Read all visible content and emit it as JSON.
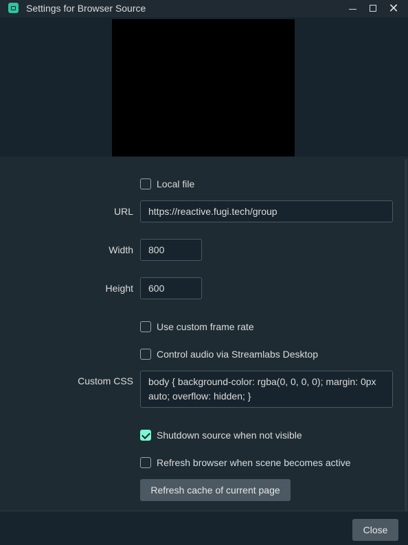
{
  "window": {
    "title": "Settings for Browser Source",
    "icon": "streamlabs-app-icon",
    "controls": [
      "minimize",
      "maximize",
      "close"
    ],
    "close_glyph": "✕"
  },
  "form": {
    "local_file": {
      "label": "Local file",
      "checked": false
    },
    "url": {
      "label": "URL",
      "value": "https://reactive.fugi.tech/group"
    },
    "width": {
      "label": "Width",
      "value": "800"
    },
    "height": {
      "label": "Height",
      "value": "600"
    },
    "custom_frame_rate": {
      "label": "Use custom frame rate",
      "checked": false
    },
    "control_audio": {
      "label": "Control audio via Streamlabs Desktop",
      "checked": false
    },
    "custom_css": {
      "label": "Custom CSS",
      "value": "body { background-color: rgba(0, 0, 0, 0); margin: 0px auto; overflow: hidden; }"
    },
    "shutdown_source": {
      "label": "Shutdown source when not visible",
      "checked": true
    },
    "refresh_browser": {
      "label": "Refresh browser when scene becomes active",
      "checked": false
    },
    "refresh_cache_button": "Refresh cache of current page"
  },
  "footer": {
    "close_button": "Close"
  },
  "colors": {
    "accent": "#80f5d2",
    "background": "#17242d",
    "panel": "#1e2b33",
    "button": "#4c5962"
  }
}
